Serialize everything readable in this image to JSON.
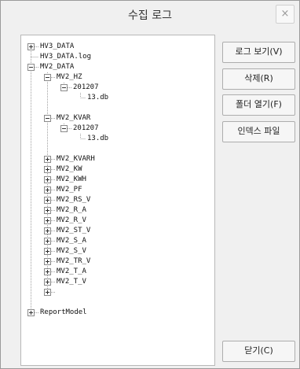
{
  "dialog": {
    "title": "수집 로그",
    "close_label": "×"
  },
  "tree": {
    "items": [
      {
        "label": "HV3_DATA"
      },
      {
        "label": "HV3_DATA.log"
      },
      {
        "label": "MV2_DATA"
      },
      {
        "label": "MV2_HZ"
      },
      {
        "label": "201207"
      },
      {
        "label": "13.db"
      },
      {
        "label": "MV2_KVAR"
      },
      {
        "label": "201207"
      },
      {
        "label": "13.db"
      },
      {
        "label": "MV2_KVARH"
      },
      {
        "label": "MV2_KW"
      },
      {
        "label": "MV2_KWH"
      },
      {
        "label": "MV2_PF"
      },
      {
        "label": "MV2_RS_V"
      },
      {
        "label": "MV2_R_A"
      },
      {
        "label": "MV2_R_V"
      },
      {
        "label": "MV2_ST_V"
      },
      {
        "label": "MV2_S_A"
      },
      {
        "label": "MV2_S_V"
      },
      {
        "label": "MV2_TR_V"
      },
      {
        "label": "MV2_T_A"
      },
      {
        "label": "MV2_T_V"
      },
      {
        "label": "ReportModel"
      }
    ]
  },
  "buttons": {
    "view_log": "로그 보기(V)",
    "delete": "삭제(R)",
    "open_folder": "폴더 열기(F)",
    "index_file": "인덱스 파일",
    "close": "닫기(C)"
  }
}
